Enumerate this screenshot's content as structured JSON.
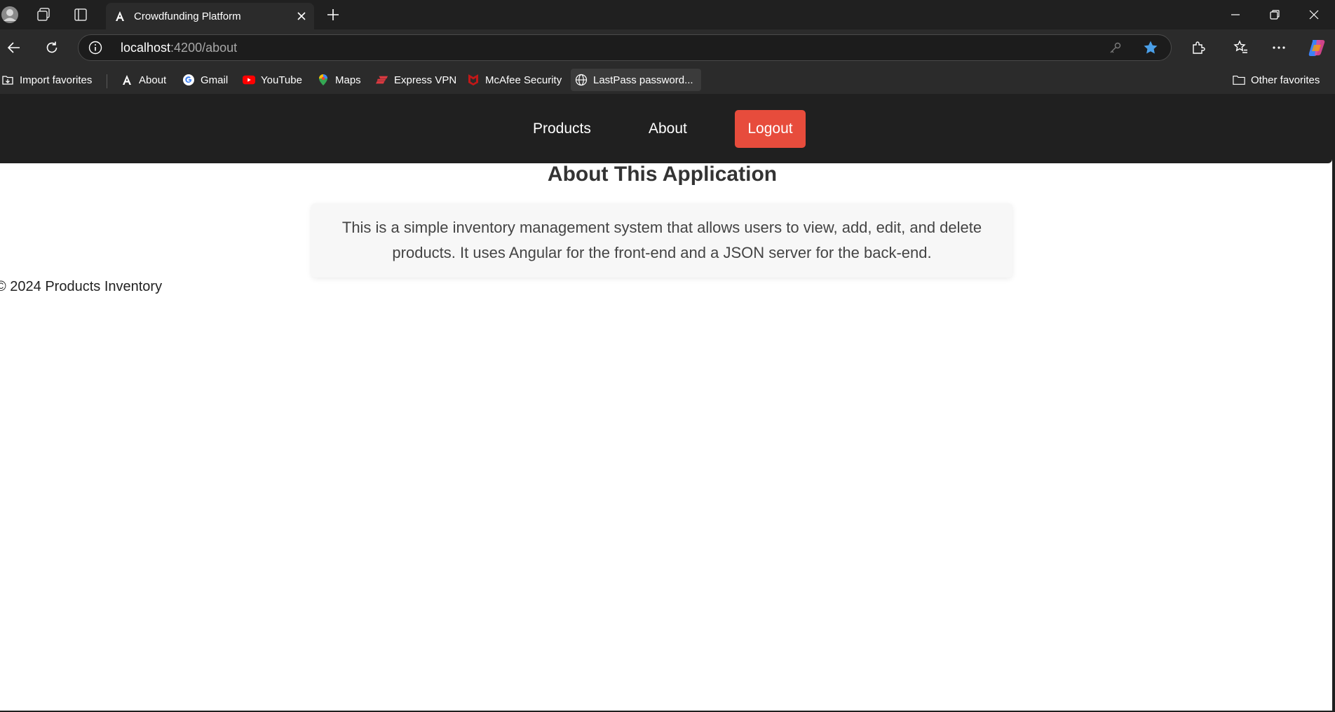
{
  "browser": {
    "tab": {
      "title": "Crowdfunding Platform",
      "favicon": "angular-a-icon"
    },
    "address": {
      "host": "localhost",
      "path": ":4200/about"
    },
    "bookmarks": [
      {
        "label": "Import favorites",
        "icon": "import-icon"
      },
      {
        "label": "About",
        "icon": "angular-a-icon"
      },
      {
        "label": "Gmail",
        "icon": "google-icon"
      },
      {
        "label": "YouTube",
        "icon": "youtube-icon"
      },
      {
        "label": "Maps",
        "icon": "map-pin-icon"
      },
      {
        "label": "Express VPN",
        "icon": "expressvpn-icon"
      },
      {
        "label": "McAfee Security",
        "icon": "mcafee-icon"
      },
      {
        "label": "LastPass password...",
        "icon": "globe-icon"
      }
    ],
    "other_favorites": "Other favorites"
  },
  "nav": {
    "products": "Products",
    "about": "About",
    "logout": "Logout"
  },
  "page": {
    "title": "About This Application",
    "description": "This is a simple inventory management system that allows users to view, add, edit, and delete products. It uses Angular for the front-end and a JSON server for the back-end.",
    "footer": "© 2024 Products Inventory"
  },
  "colors": {
    "logout_bg": "#e74c3c",
    "nav_bg": "#202020",
    "star_blue": "#4a9fe8"
  }
}
